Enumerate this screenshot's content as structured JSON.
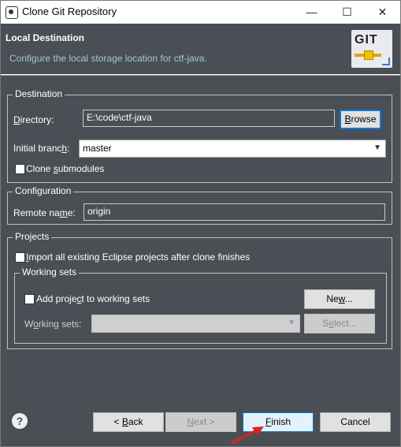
{
  "window": {
    "title": "Clone Git Repository",
    "minimize": "—",
    "maximize": "☐",
    "close": "✕"
  },
  "header": {
    "title": "Local Destination",
    "description": "Configure the local storage location for ctf-java.",
    "logo_text": "GIT"
  },
  "destination": {
    "group_label": "Destination",
    "directory_label_pre": "",
    "directory_label_u": "D",
    "directory_label_post": "irectory:",
    "directory_value": "E:\\code\\ctf-java",
    "browse_u": "B",
    "browse_post": "rowse",
    "branch_label_pre": "Initial branc",
    "branch_label_u": "h",
    "branch_label_post": ":",
    "branch_value": "master",
    "clone_submodules_pre": "Clone ",
    "clone_submodules_u": "s",
    "clone_submodules_post": "ubmodules"
  },
  "configuration": {
    "group_label": "Configuration",
    "remote_label_pre": "Remote na",
    "remote_label_u": "m",
    "remote_label_post": "e:",
    "remote_value": "origin"
  },
  "projects": {
    "group_label": "Projects",
    "import_label_pre": "",
    "import_label_u": "I",
    "import_label_post": "mport all existing Eclipse projects after clone finishes",
    "working_sets": {
      "group_label": "Working sets",
      "add_label_pre": "Add proje",
      "add_label_u": "c",
      "add_label_post": "t to working sets",
      "new_pre": "Ne",
      "new_u": "w",
      "new_post": "...",
      "sets_label_pre": "W",
      "sets_label_u": "o",
      "sets_label_post": "rking sets:",
      "select_pre": "S",
      "select_u": "e",
      "select_post": "lect..."
    }
  },
  "footer": {
    "help": "?",
    "back_pre": "< ",
    "back_u": "B",
    "back_post": "ack",
    "next_u": "N",
    "next_post": "ext >",
    "finish_u": "F",
    "finish_post": "inish",
    "cancel": "Cancel"
  },
  "colors": {
    "panel": "#4a4f55",
    "header_desc": "#9fc7d8",
    "focus": "#0078d7",
    "annotation_arrow": "#e02020"
  }
}
